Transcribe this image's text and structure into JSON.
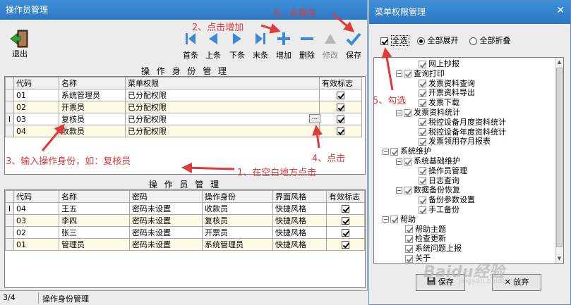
{
  "left_window": {
    "title": "操作员管理",
    "toolbar": {
      "exit": "退出",
      "first": "首条",
      "prev": "上条",
      "next": "下条",
      "last": "末条",
      "add": "增加",
      "delete": "删除",
      "edit": "修改",
      "save": "保存"
    },
    "identity_section_title": "操 作 身 份 管 理",
    "identity_table": {
      "headers": [
        "代码",
        "名称",
        "菜单权限",
        "有效标志"
      ],
      "rows": [
        [
          "01",
          "系统管理员",
          "已分配权限"
        ],
        [
          "02",
          "开票员",
          "已分配权限"
        ],
        [
          "03",
          "复核员",
          "已分配权限"
        ],
        [
          "04",
          "收款员",
          "已分配权限"
        ]
      ]
    },
    "operator_section_title": "操 作 员 管 理",
    "operator_table": {
      "headers": [
        "代码",
        "名称",
        "密码",
        "操作身份",
        "界面风格",
        "有效标志"
      ],
      "rows": [
        [
          "04",
          "王五",
          "密码未设置",
          "收款员",
          "快捷风格"
        ],
        [
          "03",
          "李四",
          "密码未设置",
          "复核员",
          "快捷风格"
        ],
        [
          "02",
          "张三",
          "密码未设置",
          "开票员",
          "快捷风格"
        ],
        [
          "01",
          "管理员",
          "密码未设置",
          "系统管理员",
          "快捷风格"
        ]
      ]
    },
    "status": {
      "record": "3/4",
      "panel": "操作身份管理"
    }
  },
  "right_window": {
    "title": "菜单权限管理",
    "select_all": "全选",
    "expand_all": "全部展开",
    "collapse_all": "全部折叠",
    "tree": [
      {
        "label": "网上抄报",
        "level": 2,
        "expander": ""
      },
      {
        "label": "查询打印",
        "level": 1,
        "expander": "−"
      },
      {
        "label": "发票资料查询",
        "level": 2,
        "expander": ""
      },
      {
        "label": "开票资料导出",
        "level": 2,
        "expander": ""
      },
      {
        "label": "发票下载",
        "level": 2,
        "expander": ""
      },
      {
        "label": "发票资料统计",
        "level": 1,
        "expander": "−"
      },
      {
        "label": "税控设备月度资料统计",
        "level": 2,
        "expander": ""
      },
      {
        "label": "税控设备年度资料统计",
        "level": 2,
        "expander": ""
      },
      {
        "label": "发票领用存月报表",
        "level": 2,
        "expander": ""
      },
      {
        "label": "系统维护",
        "level": 0,
        "expander": "−"
      },
      {
        "label": "系统基础维护",
        "level": 1,
        "expander": "−"
      },
      {
        "label": "操作员管理",
        "level": 2,
        "expander": ""
      },
      {
        "label": "日志查询",
        "level": 2,
        "expander": ""
      },
      {
        "label": "数据备份恢复",
        "level": 1,
        "expander": "−"
      },
      {
        "label": "备份参数设置",
        "level": 2,
        "expander": ""
      },
      {
        "label": "手工备份",
        "level": 2,
        "expander": ""
      },
      {
        "label": "帮助",
        "level": 0,
        "expander": "−"
      },
      {
        "label": "帮助主题",
        "level": 1,
        "expander": ""
      },
      {
        "label": "检查更新",
        "level": 1,
        "expander": ""
      },
      {
        "label": "系统问题上报",
        "level": 1,
        "expander": ""
      },
      {
        "label": "关于",
        "level": 1,
        "expander": ""
      }
    ],
    "save_button": "保存",
    "cancel_button": "放弃"
  },
  "annotations": {
    "a1": "1、在空白地方点击",
    "a2": "2、点击增加",
    "a3": "3、输入操作身份，如：复核员",
    "a4": "4、点击",
    "a5": "5、勾选",
    "a6": "6、点保存"
  },
  "watermark": {
    "brand": "Baidu经验",
    "url": "jingyan.baidu.com"
  },
  "colors": {
    "titlebar": "#2f78c3",
    "annotation": "#e03a3a",
    "row_alt": "#fffbe6"
  }
}
